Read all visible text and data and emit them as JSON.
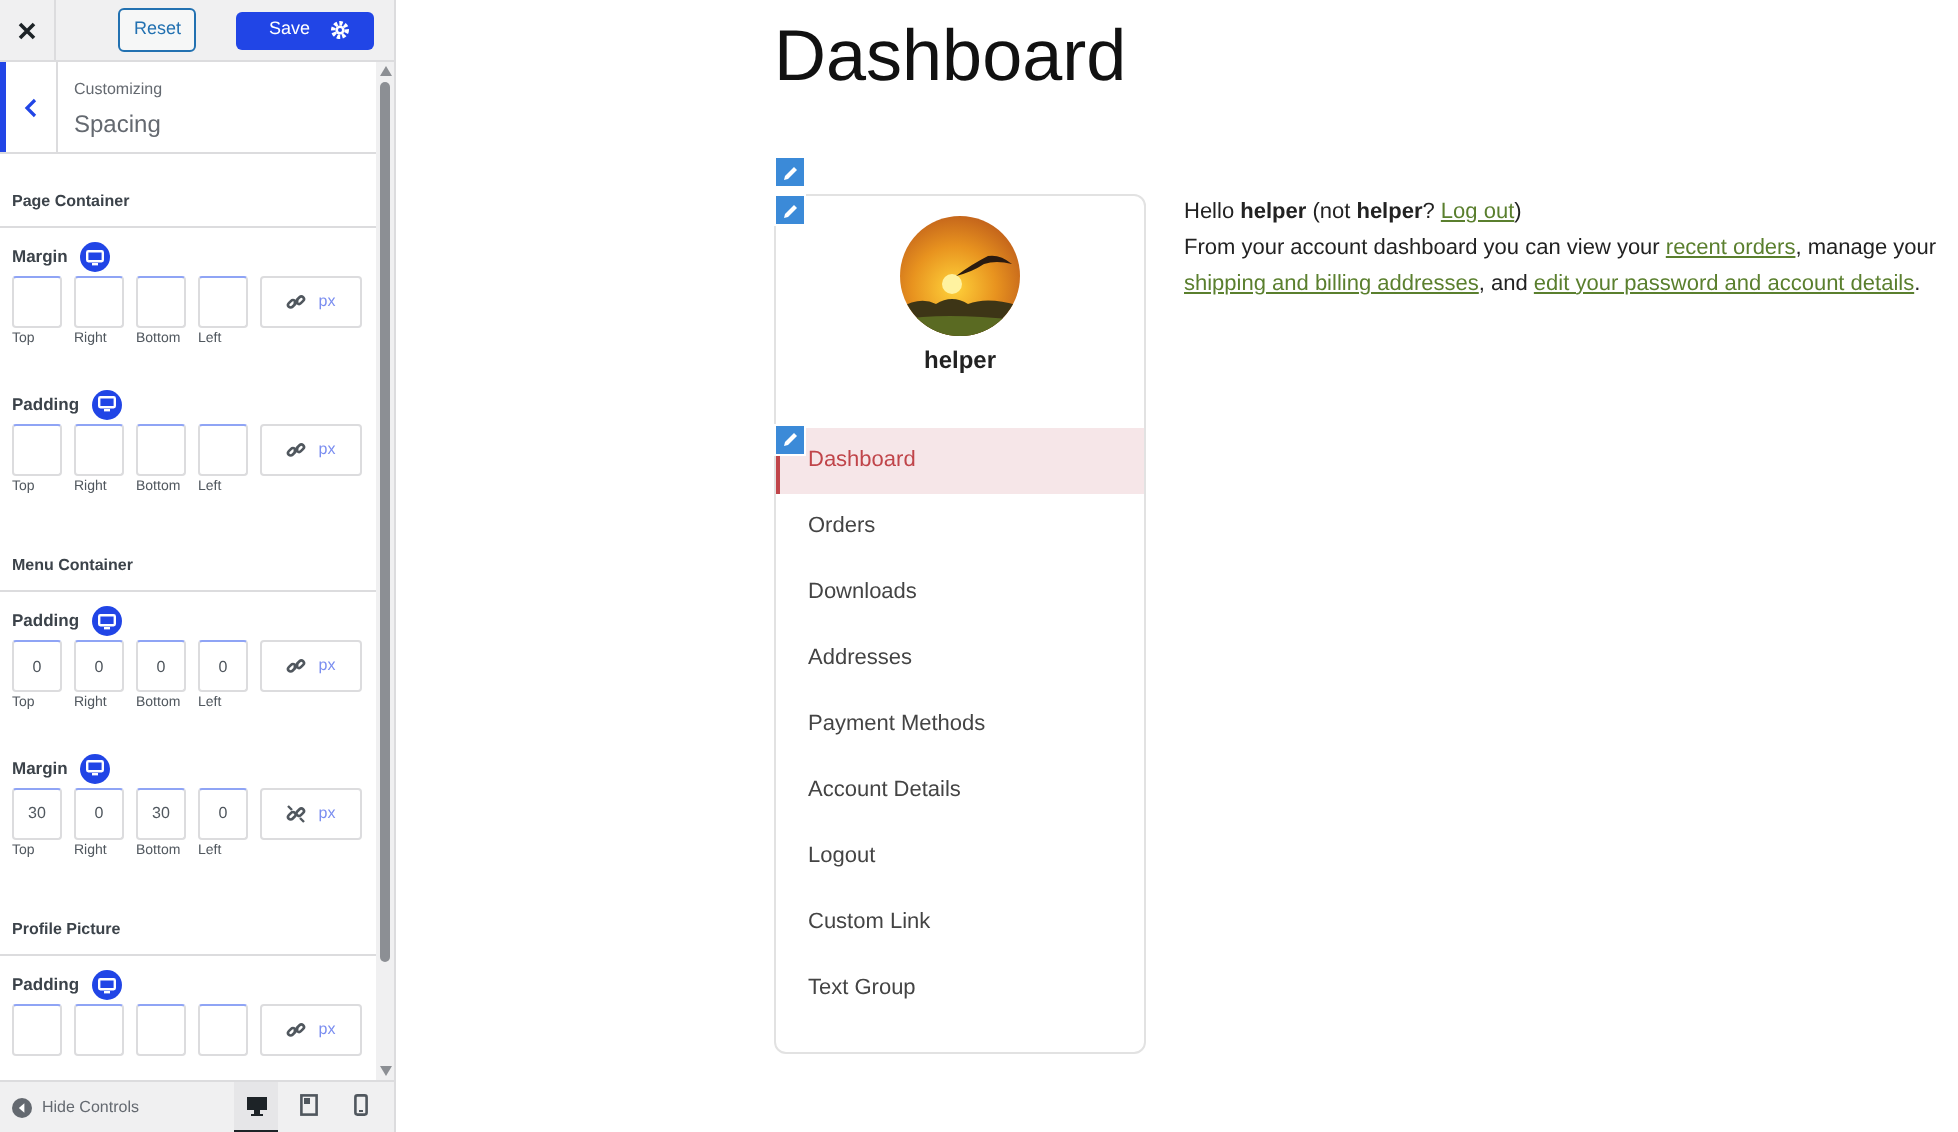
{
  "customizer": {
    "reset_label": "Reset",
    "save_label": "Save",
    "breadcrumb": "Customizing",
    "title": "Spacing",
    "sections": [
      {
        "heading": "Page Container",
        "groups": [
          {
            "label": "Margin",
            "linked": true,
            "unit": "px",
            "fields": [
              {
                "label": "Top"
              },
              {
                "label": "Right"
              },
              {
                "label": "Bottom"
              },
              {
                "label": "Left"
              }
            ]
          },
          {
            "label": "Padding",
            "linked": true,
            "unit": "px",
            "fields": [
              {
                "label": "Top"
              },
              {
                "label": "Right"
              },
              {
                "label": "Bottom"
              },
              {
                "label": "Left"
              }
            ]
          }
        ]
      },
      {
        "heading": "Menu Container",
        "groups": [
          {
            "label": "Padding",
            "linked": true,
            "unit": "px",
            "fields": [
              {
                "label": "Top",
                "value": "0"
              },
              {
                "label": "Right",
                "value": "0"
              },
              {
                "label": "Bottom",
                "value": "0"
              },
              {
                "label": "Left",
                "value": "0"
              }
            ]
          },
          {
            "label": "Margin",
            "linked": false,
            "unit": "px",
            "fields": [
              {
                "label": "Top",
                "value": "30"
              },
              {
                "label": "Right",
                "value": "0"
              },
              {
                "label": "Bottom",
                "value": "30"
              },
              {
                "label": "Left",
                "value": "0"
              }
            ]
          }
        ]
      },
      {
        "heading": "Profile Picture",
        "groups": [
          {
            "label": "Padding",
            "linked": true,
            "unit": "px"
          }
        ]
      }
    ],
    "footer": {
      "hide_label": "Hide Controls",
      "devices": [
        {
          "kind": "desktop",
          "selected": true
        },
        {
          "kind": "tablet",
          "selected": false
        },
        {
          "kind": "mobile",
          "selected": false
        }
      ]
    }
  },
  "page": {
    "title": "Dashboard",
    "username": "helper",
    "menu": [
      {
        "label": "Dashboard",
        "selected": true
      },
      {
        "label": "Orders",
        "selected": false
      },
      {
        "label": "Downloads",
        "selected": false
      },
      {
        "label": "Addresses",
        "selected": false
      },
      {
        "label": "Payment Methods",
        "selected": false
      },
      {
        "label": "Account Details",
        "selected": false
      },
      {
        "label": "Logout",
        "selected": false
      },
      {
        "label": "Custom Link",
        "selected": false
      },
      {
        "label": "Text Group",
        "selected": false
      }
    ],
    "paragraphs": [
      [
        {
          "kind": "text",
          "text": "Hello **helper** (not **helper**? "
        },
        {
          "kind": "link",
          "text": "Log out"
        },
        {
          "kind": "text",
          "text": ")"
        }
      ],
      [
        {
          "kind": "text",
          "text": "From your account dashboard you can view your "
        },
        {
          "kind": "link",
          "text": "recent orders"
        },
        {
          "kind": "text",
          "text": ", manage your "
        },
        {
          "kind": "link",
          "text": "shipping and billing addresses"
        },
        {
          "kind": "text",
          "text": ", and "
        },
        {
          "kind": "link",
          "text": "edit your password and account details"
        },
        {
          "kind": "text",
          "text": "."
        }
      ]
    ]
  }
}
